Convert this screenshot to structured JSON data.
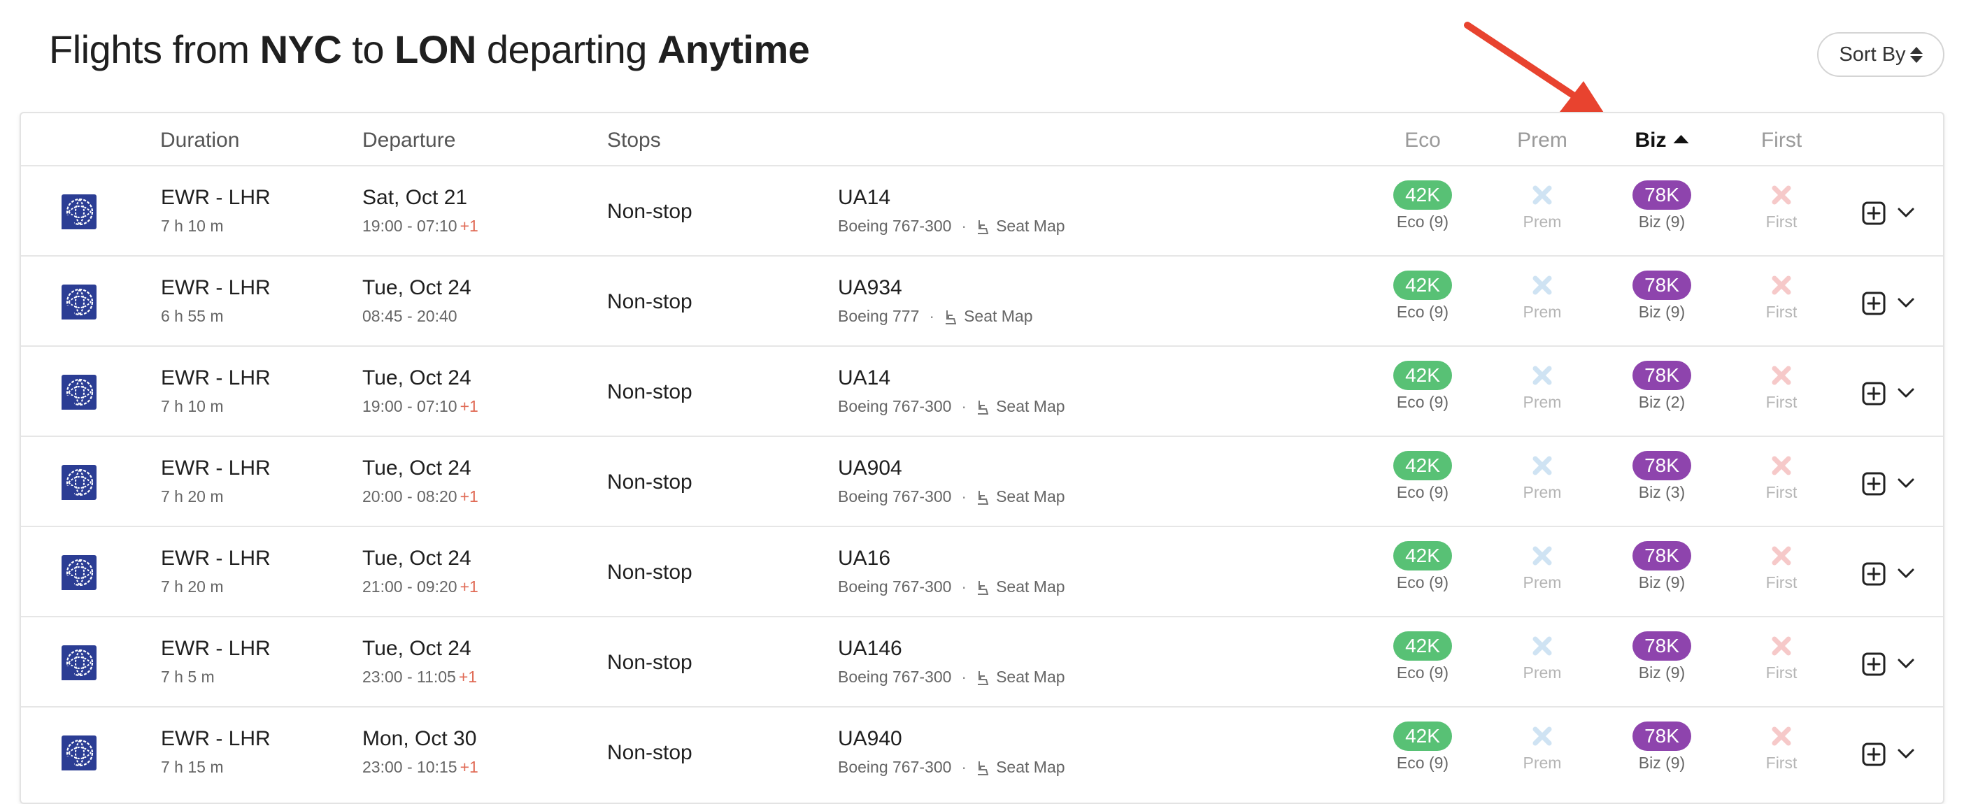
{
  "header": {
    "title_prefix": "Flights from",
    "origin": "NYC",
    "to_word": "to",
    "destination": "LON",
    "departing_word": "departing",
    "date_range": "Anytime",
    "sort_label": "Sort By"
  },
  "columns": {
    "duration": "Duration",
    "departure": "Departure",
    "stops": "Stops",
    "eco": "Eco",
    "prem": "Prem",
    "biz": "Biz",
    "first": "First"
  },
  "colors": {
    "eco_pill": "#58c175",
    "biz_pill": "#8e44ad",
    "prem_unavailable": "#cfe3f3",
    "first_unavailable": "#f6c9c9",
    "next_day": "#e06a55",
    "annotation_arrow": "#e8432f",
    "airline_logo": "#2b3d94"
  },
  "icons": {
    "airline": "united-airlines-globe-icon",
    "seat": "seat-icon",
    "unavailable": "x-icon",
    "add": "plus-square-icon",
    "expand": "chevron-down-icon",
    "sort": "sort-icon",
    "annotation": "red-arrow"
  },
  "flights": [
    {
      "route": "EWR - LHR",
      "duration": "7 h 10 m",
      "date": "Sat, Oct 21",
      "times": "19:00 - 07:10",
      "next_day": "+1",
      "stops": "Non-stop",
      "flight": "UA14",
      "aircraft": "Boeing 767-300",
      "seat_map": "Seat Map",
      "eco_price": "42K",
      "eco_label": "Eco (9)",
      "prem_label": "Prem",
      "biz_price": "78K",
      "biz_label": "Biz (9)",
      "first_label": "First"
    },
    {
      "route": "EWR - LHR",
      "duration": "6 h 55 m",
      "date": "Tue, Oct 24",
      "times": "08:45 - 20:40",
      "next_day": "",
      "stops": "Non-stop",
      "flight": "UA934",
      "aircraft": "Boeing 777",
      "seat_map": "Seat Map",
      "eco_price": "42K",
      "eco_label": "Eco (9)",
      "prem_label": "Prem",
      "biz_price": "78K",
      "biz_label": "Biz (9)",
      "first_label": "First"
    },
    {
      "route": "EWR - LHR",
      "duration": "7 h 10 m",
      "date": "Tue, Oct 24",
      "times": "19:00 - 07:10",
      "next_day": "+1",
      "stops": "Non-stop",
      "flight": "UA14",
      "aircraft": "Boeing 767-300",
      "seat_map": "Seat Map",
      "eco_price": "42K",
      "eco_label": "Eco (9)",
      "prem_label": "Prem",
      "biz_price": "78K",
      "biz_label": "Biz (2)",
      "first_label": "First"
    },
    {
      "route": "EWR - LHR",
      "duration": "7 h 20 m",
      "date": "Tue, Oct 24",
      "times": "20:00 - 08:20",
      "next_day": "+1",
      "stops": "Non-stop",
      "flight": "UA904",
      "aircraft": "Boeing 767-300",
      "seat_map": "Seat Map",
      "eco_price": "42K",
      "eco_label": "Eco (9)",
      "prem_label": "Prem",
      "biz_price": "78K",
      "biz_label": "Biz (3)",
      "first_label": "First"
    },
    {
      "route": "EWR - LHR",
      "duration": "7 h 20 m",
      "date": "Tue, Oct 24",
      "times": "21:00 - 09:20",
      "next_day": "+1",
      "stops": "Non-stop",
      "flight": "UA16",
      "aircraft": "Boeing 767-300",
      "seat_map": "Seat Map",
      "eco_price": "42K",
      "eco_label": "Eco (9)",
      "prem_label": "Prem",
      "biz_price": "78K",
      "biz_label": "Biz (9)",
      "first_label": "First"
    },
    {
      "route": "EWR - LHR",
      "duration": "7 h 5 m",
      "date": "Tue, Oct 24",
      "times": "23:00 - 11:05",
      "next_day": "+1",
      "stops": "Non-stop",
      "flight": "UA146",
      "aircraft": "Boeing 767-300",
      "seat_map": "Seat Map",
      "eco_price": "42K",
      "eco_label": "Eco (9)",
      "prem_label": "Prem",
      "biz_price": "78K",
      "biz_label": "Biz (9)",
      "first_label": "First"
    },
    {
      "route": "EWR - LHR",
      "duration": "7 h 15 m",
      "date": "Mon, Oct 30",
      "times": "23:00 - 10:15",
      "next_day": "+1",
      "stops": "Non-stop",
      "flight": "UA940",
      "aircraft": "Boeing 767-300",
      "seat_map": "Seat Map",
      "eco_price": "42K",
      "eco_label": "Eco (9)",
      "prem_label": "Prem",
      "biz_price": "78K",
      "biz_label": "Biz (9)",
      "first_label": "First"
    }
  ]
}
